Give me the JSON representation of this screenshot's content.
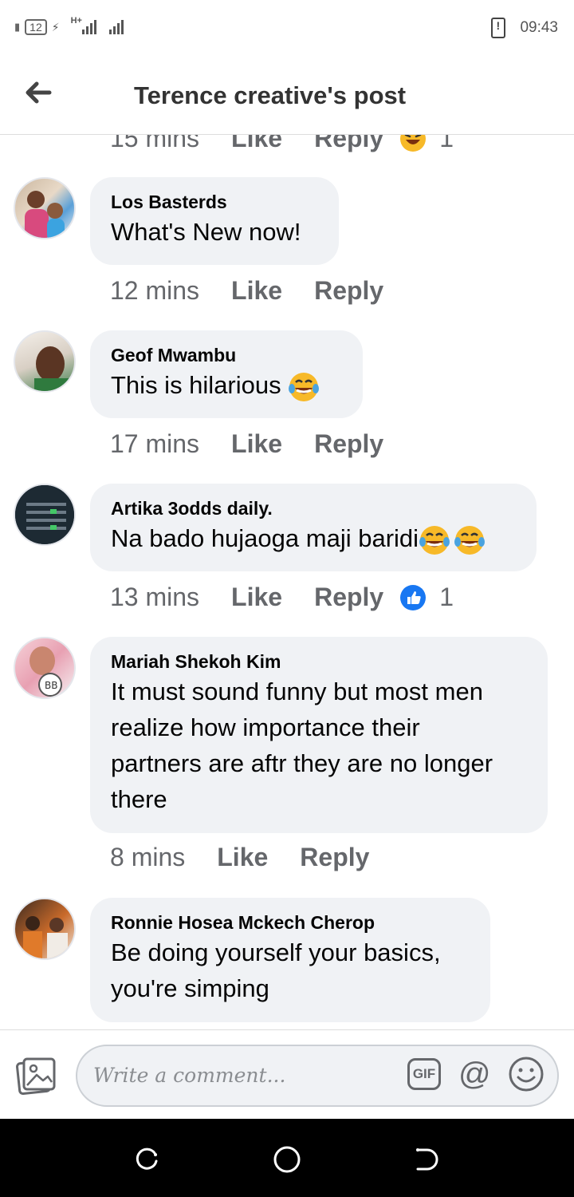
{
  "status_bar": {
    "battery": "12",
    "network": "H+",
    "time": "09:43"
  },
  "header": {
    "title": "Terence creative's post",
    "back_icon": "back-arrow-icon"
  },
  "partial_comment": {
    "time": "15 mins",
    "like_label": "Like",
    "reply_label": "Reply",
    "reaction_icon": "laugh-react-icon",
    "reaction_count": "1"
  },
  "comments": [
    {
      "author": "Los Basterds",
      "text": "What's New now!",
      "time": "12 mins",
      "like_label": "Like",
      "reply_label": "Reply"
    },
    {
      "author": "Geof Mwambu",
      "text": "This is hilarious",
      "emoji": "tears-of-joy",
      "time": "17 mins",
      "like_label": "Like",
      "reply_label": "Reply"
    },
    {
      "author": "Artika 3odds daily.",
      "text": "Na bado hujaoga maji baridi",
      "emoji": "tears-of-joy x2",
      "time": "13 mins",
      "like_label": "Like",
      "reply_label": "Reply",
      "reaction_icon": "like-react-icon",
      "reaction_count": "1"
    },
    {
      "author": "Mariah Shekoh Kim",
      "text_lines": [
        "It must sound funny but most men",
        "realize how importance their",
        "partners are aftr they are no longer",
        "there"
      ],
      "time": "8 mins",
      "like_label": "Like",
      "reply_label": "Reply"
    },
    {
      "author": "Ronnie Hosea Mckech Cherop",
      "text_lines": [
        "Be doing yourself your basics,",
        "you're simping"
      ]
    }
  ],
  "composer": {
    "placeholder": "Write a comment...",
    "gif_label": "GIF",
    "at_label": "@"
  },
  "colors": {
    "bubble": "#f0f2f5",
    "meta_text": "#65676b",
    "like_blue": "#1877f2",
    "emoji_yellow": "#f7b928"
  }
}
